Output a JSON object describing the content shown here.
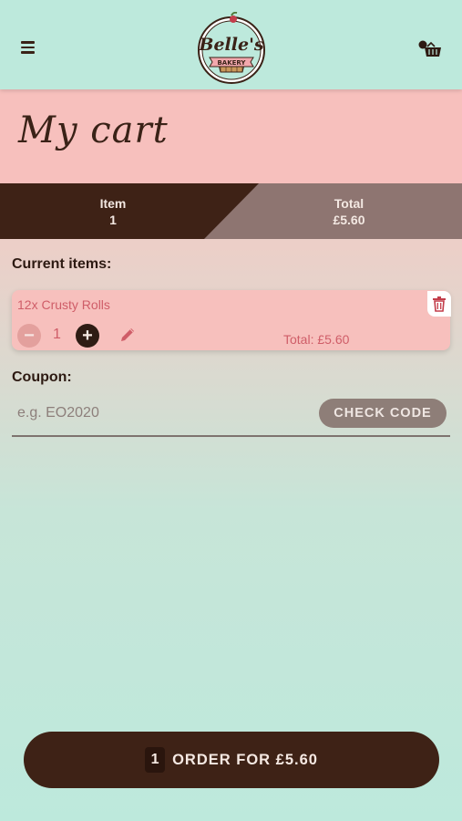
{
  "header": {
    "logo_text_main": "Belle's",
    "logo_text_sub": "BAKERY",
    "menu_icon": "hamburger-menu-icon",
    "cart_icon": "shopping-basket-icon"
  },
  "page": {
    "title": "My cart"
  },
  "summary": {
    "item_label": "Item",
    "item_value": "1",
    "total_label": "Total",
    "total_value": "£5.60"
  },
  "current_items_label": "Current items:",
  "items": [
    {
      "name": "12x Crusty Rolls",
      "quantity": "1",
      "total": "Total: £5.60"
    }
  ],
  "coupon": {
    "label": "Coupon:",
    "placeholder": "e.g. EO2020",
    "value": "",
    "button_label": "CHECK CODE"
  },
  "order_button": {
    "count": "1",
    "label": "ORDER FOR £5.60"
  },
  "colors": {
    "mint": "#bde9dc",
    "pink": "#f7c0bd",
    "dark_brown": "#3e2216",
    "taupe": "#8e7e78",
    "accent_red": "#cf5d68"
  }
}
